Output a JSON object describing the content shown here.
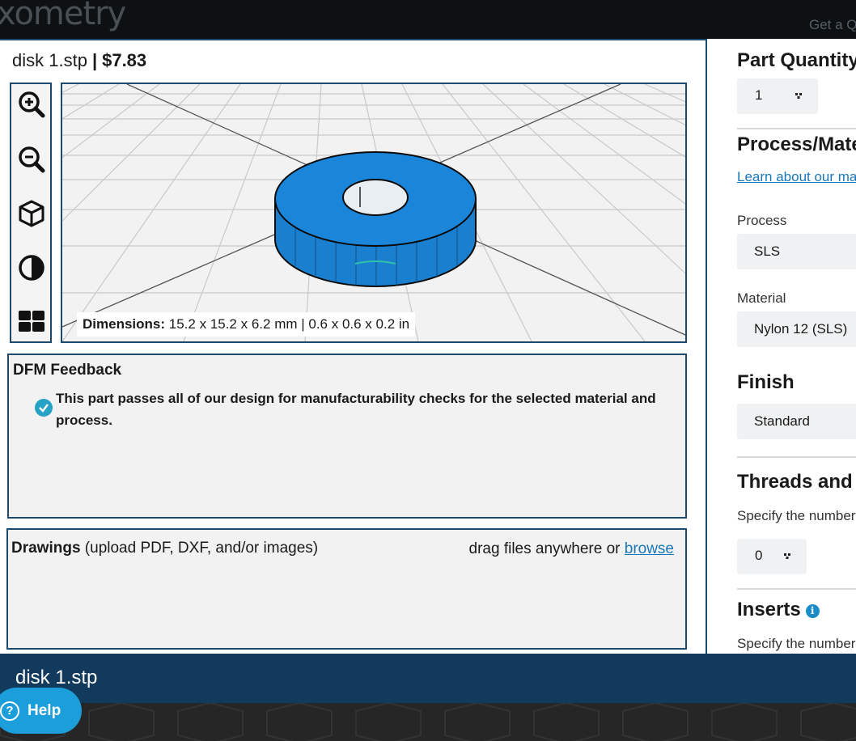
{
  "brand": {
    "logo_text": "xometry",
    "top_link": "Get a Q"
  },
  "file": {
    "name": "disk 1.stp",
    "separator": "|",
    "price": "$7.83"
  },
  "toolbar": {
    "items": [
      {
        "name": "zoom-in",
        "icon": "zoom-in-icon"
      },
      {
        "name": "zoom-out",
        "icon": "zoom-out-icon"
      },
      {
        "name": "cube-view",
        "icon": "cube-icon"
      },
      {
        "name": "contrast",
        "icon": "contrast-icon"
      },
      {
        "name": "layout",
        "icon": "grid-icon"
      }
    ]
  },
  "viewer": {
    "dimensions_label": "Dimensions:",
    "dimensions_value": "15.2 x 15.2 x 6.2 mm | 0.6 x 0.6 x 0.2 in",
    "part_color": "#1a86d9"
  },
  "dfm": {
    "title": "DFM Feedback",
    "message": "This part passes all of our design for manufacturability checks for the selected material and process.",
    "status_color": "#25a2c4"
  },
  "drawings": {
    "title": "Drawings",
    "subtitle": " (upload PDF, DXF, and/or images)",
    "drag_text": "drag files anywhere or ",
    "browse_link": "browse"
  },
  "config": {
    "quantity": {
      "title": "Part Quantity",
      "value": "1"
    },
    "process_material": {
      "title": "Process/Material",
      "learn_link": "Learn about our materials",
      "process_label": "Process",
      "process_value": "SLS",
      "material_label": "Material",
      "material_value": "Nylon 12 (SLS)"
    },
    "finish": {
      "title": "Finish",
      "value": "Standard"
    },
    "threads": {
      "title": "Threads and Tapped Holes",
      "help": "Specify the number of threaded holes",
      "value": "0"
    },
    "inserts": {
      "title": "Inserts",
      "help": "Specify the number of inserts"
    }
  },
  "bottom": {
    "file_name": "disk 1.stp",
    "help_label": "Help"
  },
  "colors": {
    "accent": "#1d4a6b",
    "link": "#1a78b8",
    "bottom_bar": "#113a5c",
    "help_button": "#1b9ed9"
  }
}
